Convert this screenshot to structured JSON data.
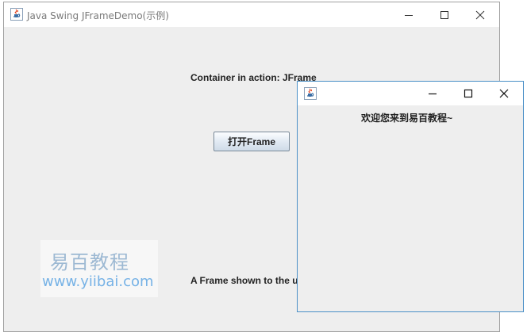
{
  "main_window": {
    "title": "Java Swing JFrameDemo(示例)",
    "label_top": "Container in action: JFrame",
    "open_button": "打开Frame",
    "label_bottom": "A Frame shown to the user.",
    "controls": [
      "minimize-icon",
      "maximize-icon",
      "close-icon"
    ]
  },
  "sub_window": {
    "title": "",
    "message": "欢迎您来到易百教程~",
    "controls": [
      "minimize-icon",
      "maximize-icon",
      "close-icon"
    ]
  },
  "watermark": {
    "cn": "易百教程",
    "url": "www.yiibai.com"
  },
  "colors": {
    "frame_bg": "#eeeeee",
    "active_border": "#4a8fc7",
    "watermark_url": "#76b2e6"
  },
  "icons": [
    "java-icon",
    "minimize-icon",
    "maximize-icon",
    "close-icon"
  ]
}
